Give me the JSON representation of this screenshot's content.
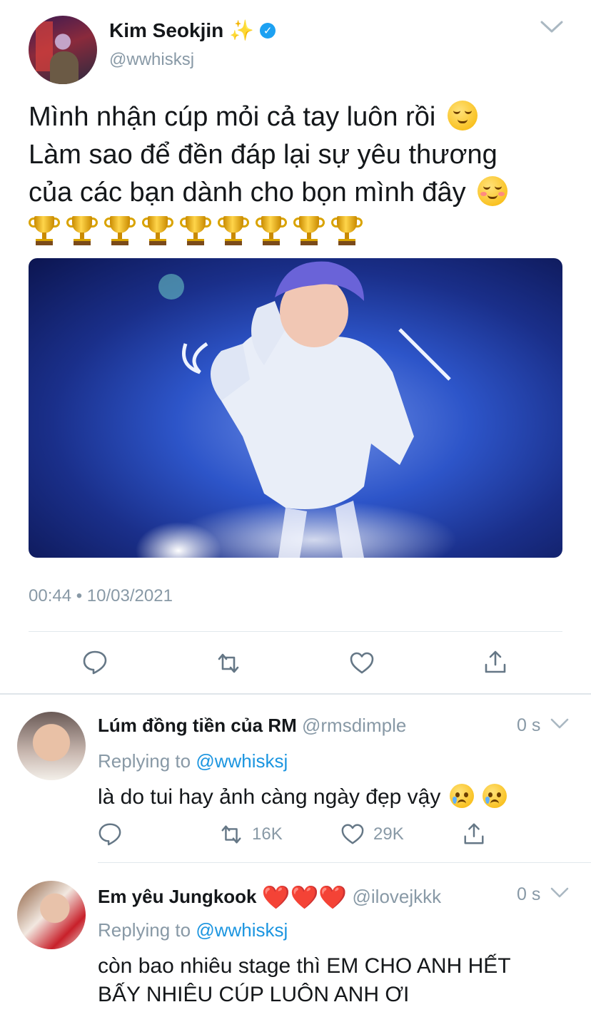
{
  "main_tweet": {
    "name": "Kim Seokjin",
    "name_emoji": "✨",
    "handle": "@wwhisksj",
    "text_lines": [
      "Mình nhận cúp mỏi cả tay luôn rồi",
      "Làm sao để đền đáp lại sự yêu thương",
      "của các bạn dành cho bọn mình đây"
    ],
    "trophy_count": 9,
    "timestamp": "00:44 • 10/03/2021",
    "icons": [
      "reply-icon",
      "retweet-icon",
      "like-icon",
      "share-icon"
    ]
  },
  "replies": [
    {
      "name": "Lúm đồng tiền của RM",
      "handle": "@rmsdimple",
      "time": "0 s",
      "replying_prefix": "Replying to",
      "replying_to": "@wwhisksj",
      "text": "là do tui hay ảnh càng ngày đẹp vậy",
      "retweets": "16K",
      "likes": "29K"
    },
    {
      "name": "Em yêu Jungkook",
      "name_emoji": "❤️❤️❤️",
      "handle": "@ilovejkkk",
      "time": "0 s",
      "replying_prefix": "Replying to",
      "replying_to": "@wwhisksj",
      "text_lines": [
        "còn bao nhiêu stage thì EM CHO ANH HẾT",
        "BẤY NHIÊU CÚP LUÔN ANH ƠI"
      ]
    }
  ],
  "colors": {
    "accent": "#1da1f2",
    "mention": "#1b95e0",
    "secondary_text": "#8899a6",
    "divider": "#e1e8ed"
  }
}
